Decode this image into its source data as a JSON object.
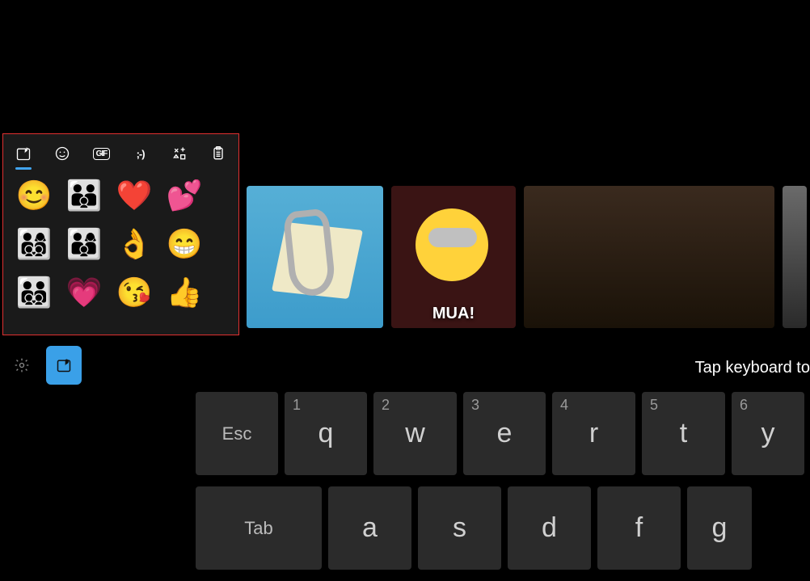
{
  "panel": {
    "tabs": [
      {
        "name": "recent",
        "active": true
      },
      {
        "name": "emoji"
      },
      {
        "name": "gif",
        "label": "GIF"
      },
      {
        "name": "kaomoji",
        "label": ";-)"
      },
      {
        "name": "symbols"
      },
      {
        "name": "clipboard"
      }
    ]
  },
  "emoji": [
    "😊",
    "👨‍👨‍👦",
    "❤️",
    "💕",
    "👨‍👩‍👦‍👦",
    "👨‍👩‍👦",
    "👌",
    "😁",
    "👨‍👨‍👦‍👦",
    "💗",
    "😘",
    "👍"
  ],
  "gifs": [
    {
      "name": "clippy",
      "caption": ""
    },
    {
      "name": "minion-mua",
      "caption": "MUA!"
    },
    {
      "name": "oscars-applause",
      "caption": ""
    },
    {
      "name": "gif-more",
      "caption": ""
    }
  ],
  "hint": "Tap keyboard to",
  "keyboard": {
    "row1": [
      {
        "label": "Esc",
        "w": 102,
        "small": true
      },
      {
        "label": "q",
        "num": "1",
        "w": 102
      },
      {
        "label": "w",
        "num": "2",
        "w": 103
      },
      {
        "label": "e",
        "num": "3",
        "w": 102
      },
      {
        "label": "r",
        "num": "4",
        "w": 103
      },
      {
        "label": "t",
        "num": "5",
        "w": 103
      },
      {
        "label": "y",
        "num": "6",
        "w": 90
      }
    ],
    "row2": [
      {
        "label": "Tab",
        "w": 156,
        "small": true
      },
      {
        "label": "a",
        "w": 103
      },
      {
        "label": "s",
        "w": 103
      },
      {
        "label": "d",
        "w": 103
      },
      {
        "label": "f",
        "w": 103
      },
      {
        "label": "g",
        "w": 103
      }
    ]
  }
}
